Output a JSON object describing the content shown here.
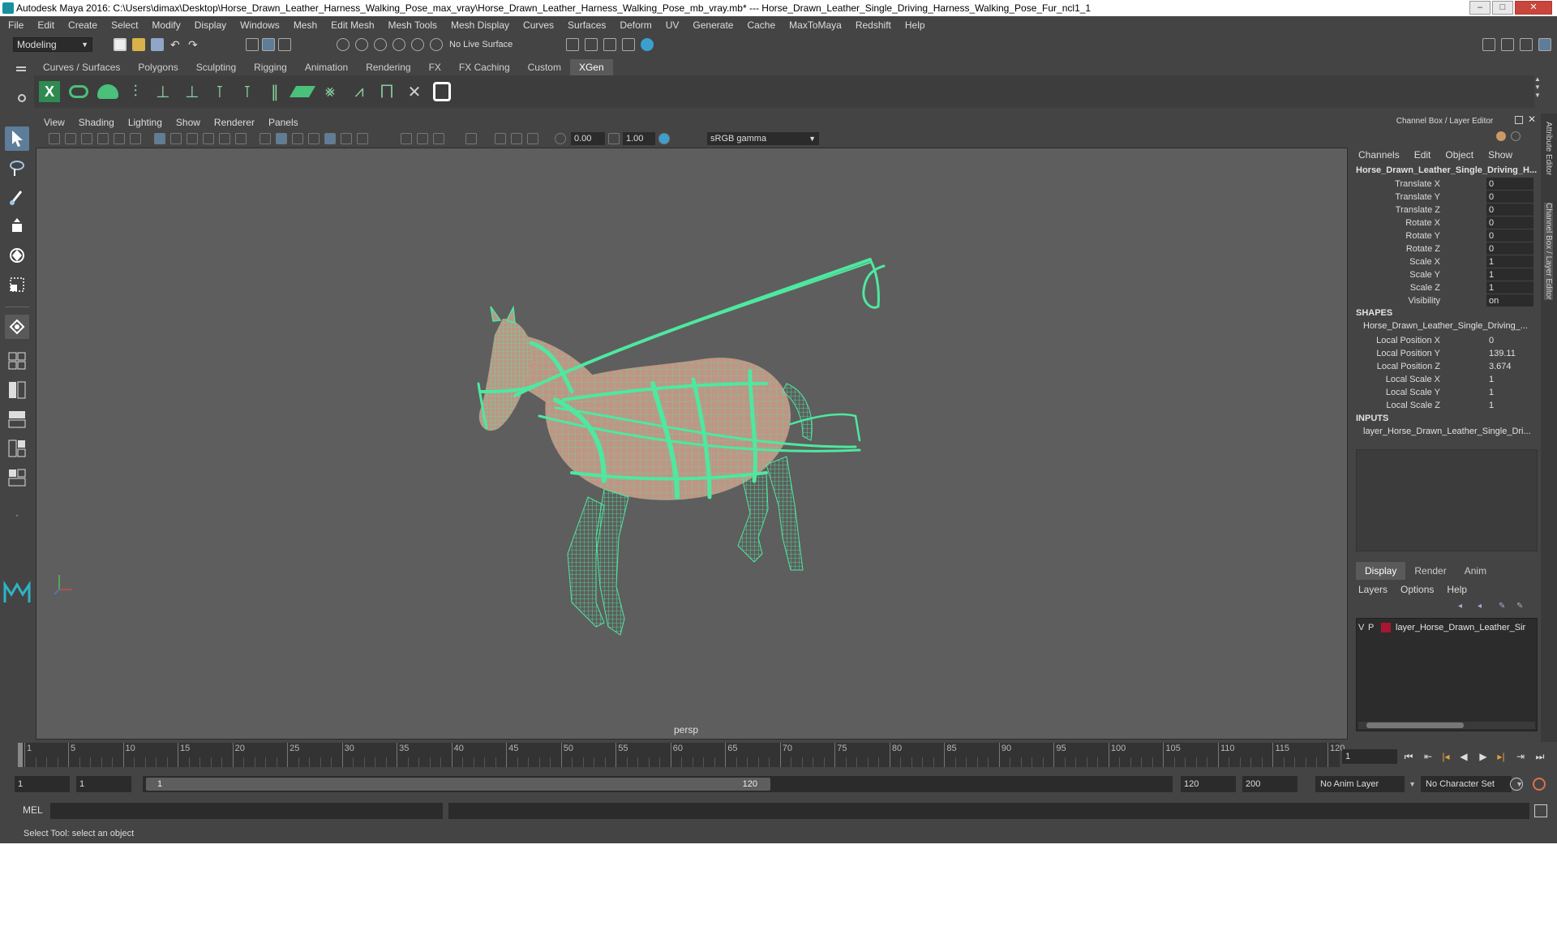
{
  "window": {
    "title": "Autodesk Maya 2016: C:\\Users\\dimax\\Desktop\\Horse_Drawn_Leather_Harness_Walking_Pose_max_vray\\Horse_Drawn_Leather_Harness_Walking_Pose_mb_vray.mb*   ---   Horse_Drawn_Leather_Single_Driving_Harness_Walking_Pose_Fur_ncl1_1",
    "controls": [
      "–",
      "□",
      "✕"
    ]
  },
  "menubar": [
    "File",
    "Edit",
    "Create",
    "Select",
    "Modify",
    "Display",
    "Windows",
    "Mesh",
    "Edit Mesh",
    "Mesh Tools",
    "Mesh Display",
    "Curves",
    "Surfaces",
    "Deform",
    "UV",
    "Generate",
    "Cache",
    "MaxToMaya",
    "Redshift",
    "Help"
  ],
  "statusline": {
    "mode": "Modeling",
    "live_surface": "No Live Surface"
  },
  "shelf": {
    "tabs": [
      "Curves / Surfaces",
      "Polygons",
      "Sculpting",
      "Rigging",
      "Animation",
      "Rendering",
      "FX",
      "FX Caching",
      "Custom",
      "XGen"
    ],
    "active_tab": "XGen"
  },
  "viewport": {
    "menu": [
      "View",
      "Shading",
      "Lighting",
      "Show",
      "Renderer",
      "Panels"
    ],
    "exposure": "0.00",
    "gamma": "1.00",
    "color_space": "sRGB gamma",
    "camera_label": "persp",
    "wire_color": "#4ee8a0"
  },
  "channel_box": {
    "title": "Channel Box / Layer Editor",
    "menu": [
      "Channels",
      "Edit",
      "Object",
      "Show"
    ],
    "object_name": "Horse_Drawn_Leather_Single_Driving_H...",
    "channels": [
      {
        "label": "Translate X",
        "value": "0"
      },
      {
        "label": "Translate Y",
        "value": "0"
      },
      {
        "label": "Translate Z",
        "value": "0"
      },
      {
        "label": "Rotate X",
        "value": "0"
      },
      {
        "label": "Rotate Y",
        "value": "0"
      },
      {
        "label": "Rotate Z",
        "value": "0"
      },
      {
        "label": "Scale X",
        "value": "1"
      },
      {
        "label": "Scale Y",
        "value": "1"
      },
      {
        "label": "Scale Z",
        "value": "1"
      },
      {
        "label": "Visibility",
        "value": "on"
      }
    ],
    "shapes_header": "SHAPES",
    "shape_name": "Horse_Drawn_Leather_Single_Driving_...",
    "shape_channels": [
      {
        "label": "Local Position X",
        "value": "0"
      },
      {
        "label": "Local Position Y",
        "value": "139.11"
      },
      {
        "label": "Local Position Z",
        "value": "3.674"
      },
      {
        "label": "Local Scale X",
        "value": "1"
      },
      {
        "label": "Local Scale Y",
        "value": "1"
      },
      {
        "label": "Local Scale Z",
        "value": "1"
      }
    ],
    "inputs_header": "INPUTS",
    "input_name": "layer_Horse_Drawn_Leather_Single_Dri..."
  },
  "layer_editor": {
    "tabs": [
      "Display",
      "Render",
      "Anim"
    ],
    "active_tab": "Display",
    "menu": [
      "Layers",
      "Options",
      "Help"
    ],
    "layers": [
      {
        "v": "V",
        "p": "P",
        "name": "layer_Horse_Drawn_Leather_Sir",
        "color": "#a8162f"
      }
    ]
  },
  "side_tabs": [
    "Attribute Editor",
    "Channel Box / Layer Editor"
  ],
  "timeline": {
    "ticks": [
      "1",
      "5",
      "10",
      "15",
      "20",
      "25",
      "30",
      "35",
      "40",
      "45",
      "50",
      "55",
      "60",
      "65",
      "70",
      "75",
      "80",
      "85",
      "90",
      "95",
      "100",
      "105",
      "110",
      "115",
      "120"
    ],
    "current_frame": "1"
  },
  "range": {
    "start": "1",
    "playback_start": "1",
    "slider_start": "1",
    "slider_end": "120",
    "playback_end": "120",
    "end": "200",
    "anim_layer": "No Anim Layer",
    "character_set": "No Character Set"
  },
  "commandline": {
    "label": "MEL"
  },
  "helpline": "Select Tool: select an object"
}
